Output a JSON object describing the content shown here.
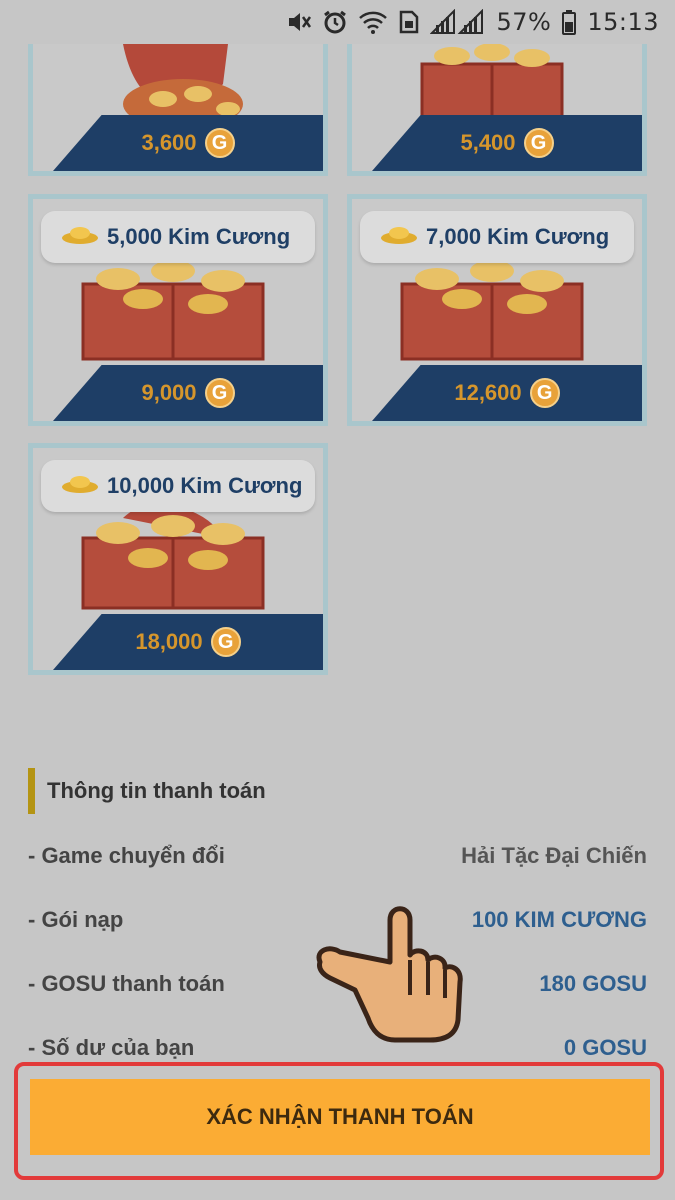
{
  "status_bar": {
    "battery_percent": "57%",
    "time": "15:13"
  },
  "packages": [
    {
      "label": "",
      "price": "3,600",
      "coin_symbol": "G"
    },
    {
      "label": "",
      "price": "5,400",
      "coin_symbol": "G"
    },
    {
      "label": "5,000 Kim Cương",
      "price": "9,000",
      "coin_symbol": "G"
    },
    {
      "label": "7,000 Kim Cương",
      "price": "12,600",
      "coin_symbol": "G"
    },
    {
      "label": "10,000 Kim Cương",
      "price": "18,000",
      "coin_symbol": "G"
    }
  ],
  "payment_info": {
    "title": "Thông tin thanh toán",
    "rows": [
      {
        "label": "- Game chuyển đổi",
        "value": "Hải Tặc Đại Chiến",
        "value_color": "#555555"
      },
      {
        "label": "- Gói nạp",
        "value": "100 KIM CƯƠNG",
        "value_color": "#2e5f8f"
      },
      {
        "label": "- GOSU thanh toán",
        "value": "180 GOSU",
        "value_color": "#2e5f8f"
      },
      {
        "label": "- Số dư của bạn",
        "value": "0 GOSU",
        "value_color": "#2e5f8f"
      }
    ]
  },
  "confirm_button": {
    "label": "XÁC NHẬN THANH TOÁN"
  },
  "colors": {
    "accent_orange": "#fbac34",
    "price_bar": "#1e3e66",
    "highlight_border": "#e23a3a"
  },
  "icons": [
    "mute-icon",
    "alarm-icon",
    "wifi-icon",
    "sim-icon",
    "signal-icon",
    "battery-icon",
    "gold-ingot-icon",
    "treasure-chest-icon",
    "gosu-coin-icon",
    "pointing-hand-icon"
  ]
}
